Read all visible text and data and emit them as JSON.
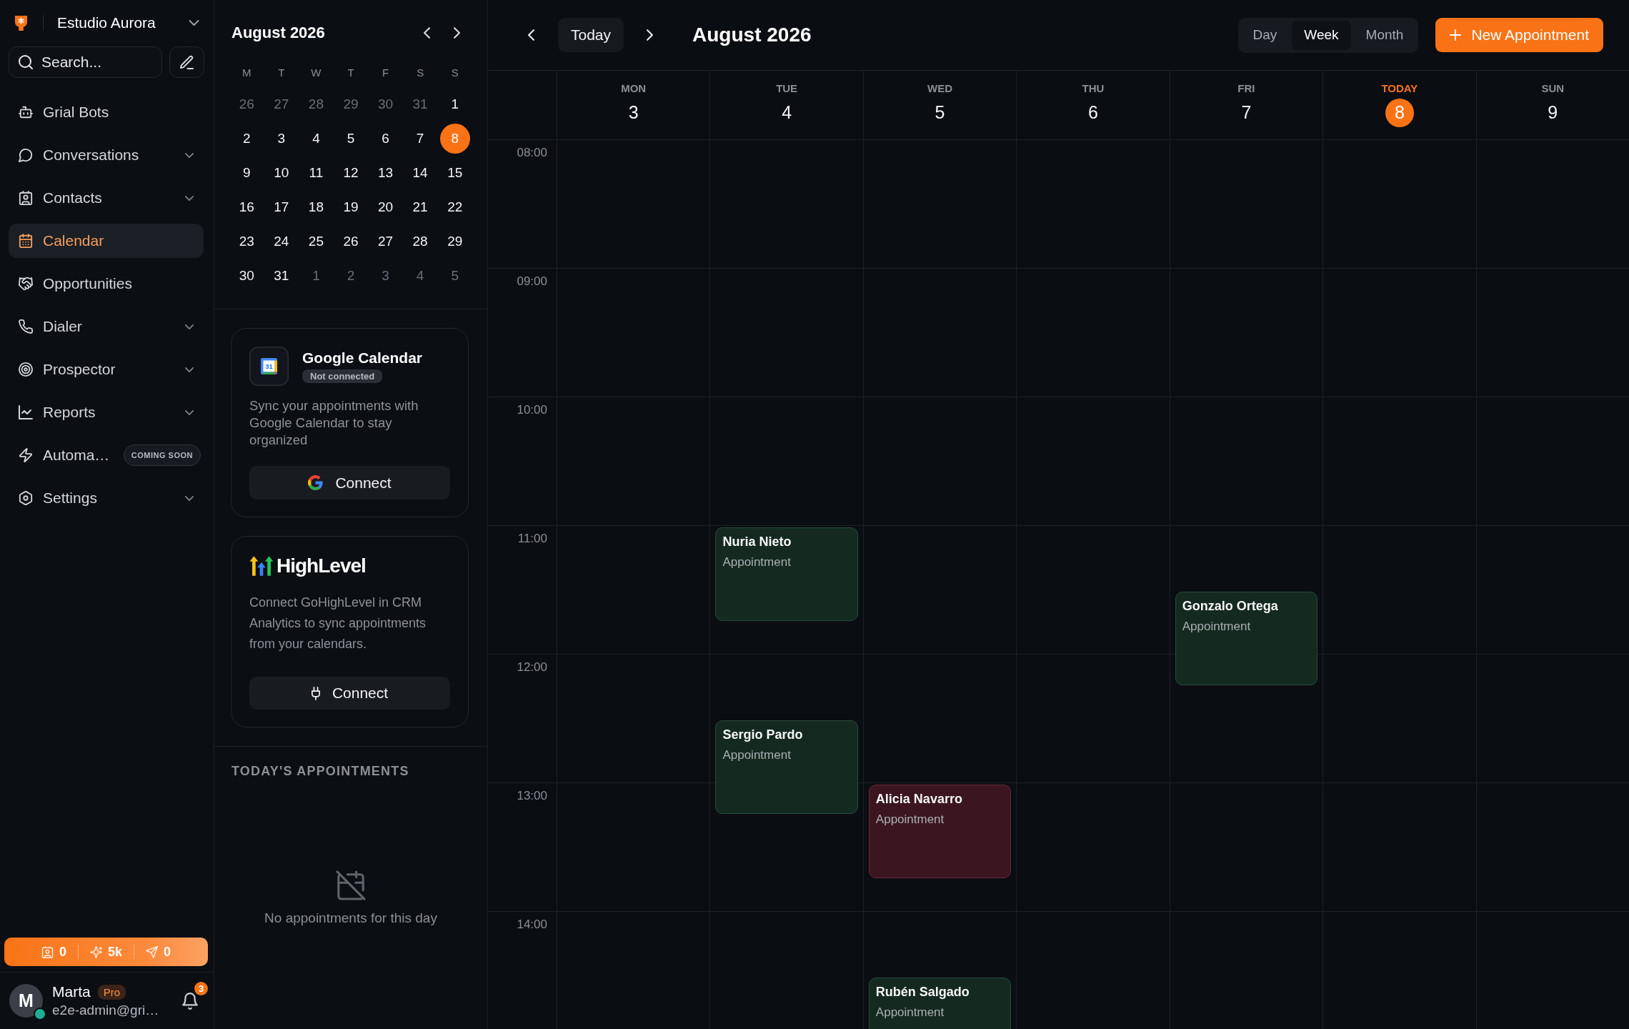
{
  "sidebar": {
    "workspace": "Estudio Aurora",
    "search": {
      "placeholder": "Search..."
    },
    "nav": [
      {
        "label": "Grial Bots",
        "kind": "link",
        "selected": false
      },
      {
        "label": "Conversations",
        "kind": "group",
        "selected": false
      },
      {
        "label": "Contacts",
        "kind": "group",
        "selected": false
      },
      {
        "label": "Calendar",
        "kind": "link",
        "selected": true
      },
      {
        "label": "Opportunities",
        "kind": "link",
        "selected": false
      },
      {
        "label": "Dialer",
        "kind": "group",
        "selected": false
      },
      {
        "label": "Prospector",
        "kind": "group",
        "selected": false
      },
      {
        "label": "Reports",
        "kind": "group",
        "selected": false
      },
      {
        "label": "Automa…",
        "kind": "link",
        "selected": false,
        "badge": "COMING SOON"
      },
      {
        "label": "Settings",
        "kind": "group",
        "selected": false
      }
    ],
    "stats": [
      {
        "value": "0"
      },
      {
        "value": "5k"
      },
      {
        "value": "0"
      }
    ],
    "user": {
      "initial": "M",
      "name": "Marta",
      "plan": "Pro",
      "email": "e2e-admin@gri…",
      "online": true,
      "notifications": "3"
    }
  },
  "mini_calendar": {
    "title": "August 2026",
    "weekdays": [
      "M",
      "T",
      "W",
      "T",
      "F",
      "S",
      "S"
    ],
    "weeks": [
      [
        {
          "day": "26",
          "outside": true,
          "selected": false
        },
        {
          "day": "27",
          "outside": true,
          "selected": false
        },
        {
          "day": "28",
          "outside": true,
          "selected": false
        },
        {
          "day": "29",
          "outside": true,
          "selected": false
        },
        {
          "day": "30",
          "outside": true,
          "selected": false
        },
        {
          "day": "31",
          "outside": true,
          "selected": false
        },
        {
          "day": "1",
          "outside": false,
          "selected": false
        }
      ],
      [
        {
          "day": "2",
          "outside": false,
          "selected": false
        },
        {
          "day": "3",
          "outside": false,
          "selected": false
        },
        {
          "day": "4",
          "outside": false,
          "selected": false
        },
        {
          "day": "5",
          "outside": false,
          "selected": false
        },
        {
          "day": "6",
          "outside": false,
          "selected": false
        },
        {
          "day": "7",
          "outside": false,
          "selected": false
        },
        {
          "day": "8",
          "outside": false,
          "selected": true
        }
      ],
      [
        {
          "day": "9",
          "outside": false,
          "selected": false
        },
        {
          "day": "10",
          "outside": false,
          "selected": false
        },
        {
          "day": "11",
          "outside": false,
          "selected": false
        },
        {
          "day": "12",
          "outside": false,
          "selected": false
        },
        {
          "day": "13",
          "outside": false,
          "selected": false
        },
        {
          "day": "14",
          "outside": false,
          "selected": false
        },
        {
          "day": "15",
          "outside": false,
          "selected": false
        }
      ],
      [
        {
          "day": "16",
          "outside": false,
          "selected": false
        },
        {
          "day": "17",
          "outside": false,
          "selected": false
        },
        {
          "day": "18",
          "outside": false,
          "selected": false
        },
        {
          "day": "19",
          "outside": false,
          "selected": false
        },
        {
          "day": "20",
          "outside": false,
          "selected": false
        },
        {
          "day": "21",
          "outside": false,
          "selected": false
        },
        {
          "day": "22",
          "outside": false,
          "selected": false
        }
      ],
      [
        {
          "day": "23",
          "outside": false,
          "selected": false
        },
        {
          "day": "24",
          "outside": false,
          "selected": false
        },
        {
          "day": "25",
          "outside": false,
          "selected": false
        },
        {
          "day": "26",
          "outside": false,
          "selected": false
        },
        {
          "day": "27",
          "outside": false,
          "selected": false
        },
        {
          "day": "28",
          "outside": false,
          "selected": false
        },
        {
          "day": "29",
          "outside": false,
          "selected": false
        }
      ],
      [
        {
          "day": "30",
          "outside": false,
          "selected": false
        },
        {
          "day": "31",
          "outside": false,
          "selected": false
        },
        {
          "day": "1",
          "outside": true,
          "selected": false
        },
        {
          "day": "2",
          "outside": true,
          "selected": false
        },
        {
          "day": "3",
          "outside": true,
          "selected": false
        },
        {
          "day": "4",
          "outside": true,
          "selected": false
        },
        {
          "day": "5",
          "outside": true,
          "selected": false
        }
      ]
    ]
  },
  "integrations": [
    {
      "kind": "google",
      "icon_text": "31",
      "title": "Google Calendar",
      "status": "Not connected",
      "description": "Sync your appointments with Google Calendar to stay organized",
      "button": "Connect"
    },
    {
      "kind": "highlevel",
      "title": "HighLevel",
      "description": "Connect GoHighLevel in CRM Analytics to sync appointments from your calendars.",
      "button": "Connect"
    }
  ],
  "today_appointments": {
    "title": "TODAY'S APPOINTMENTS",
    "empty_message": "No appointments for this day"
  },
  "toolbar": {
    "today_button": "Today",
    "title": "August 2026",
    "views": [
      {
        "label": "Day",
        "selected": false
      },
      {
        "label": "Week",
        "selected": true
      },
      {
        "label": "Month",
        "selected": false
      }
    ],
    "new_button": "New Appointment"
  },
  "week": {
    "hours": [
      "08:00",
      "09:00",
      "10:00",
      "11:00",
      "12:00",
      "13:00",
      "14:00"
    ],
    "days": [
      {
        "name": "MON",
        "date": "3",
        "today": false
      },
      {
        "name": "TUE",
        "date": "4",
        "today": false,
        "events": [
          {
            "name": "Nuria Nieto",
            "type": "Appointment",
            "color": "#142a20"
          },
          {
            "name": "Sergio Pardo",
            "type": "Appointment",
            "color": "#142a20"
          }
        ]
      },
      {
        "name": "WED",
        "date": "5",
        "today": false,
        "events": [
          {
            "name": "Alicia Navarro",
            "type": "Appointment",
            "color": "#3b1620"
          },
          {
            "name": "Rubén Salgado",
            "type": "Appointment",
            "color": "#142a20"
          }
        ]
      },
      {
        "name": "THU",
        "date": "6",
        "today": false
      },
      {
        "name": "FRI",
        "date": "7",
        "today": false,
        "events": [
          {
            "name": "Gonzalo Ortega",
            "type": "Appointment",
            "color": "#142a20"
          }
        ]
      },
      {
        "name": "TODAY",
        "date": "8",
        "today": true
      },
      {
        "name": "SUN",
        "date": "9",
        "today": false
      }
    ]
  }
}
